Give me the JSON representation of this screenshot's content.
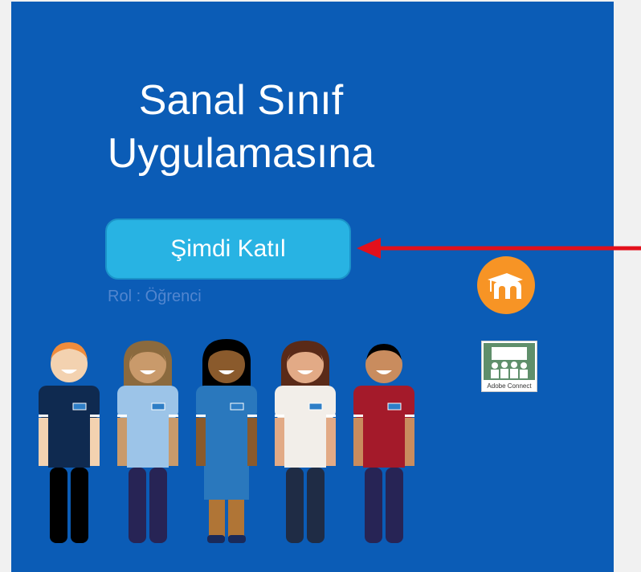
{
  "title": {
    "line1": "Sanal Sınıf",
    "line2": "Uygulamasına"
  },
  "join_button": {
    "label": "Şimdi Katıl"
  },
  "role_text": "Rol : Öğrenci",
  "adobe_connect": {
    "caption": "Adobe Connect"
  },
  "people": {
    "badge": "NHS"
  },
  "colors": {
    "panel_background": "#0b5cb6",
    "button": "#28b3e3",
    "arrow": "#e3101b",
    "moodle_orange": "#f79425"
  },
  "icons": [
    "moodle-logo",
    "adobe-connect-logo",
    "red-arrow"
  ]
}
